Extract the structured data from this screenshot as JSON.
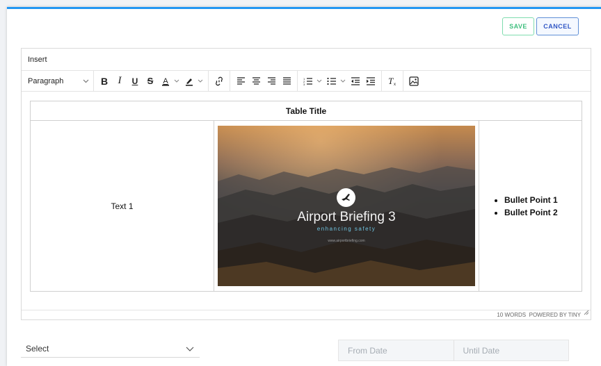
{
  "actions": {
    "save_label": "SAVE",
    "cancel_label": "CANCEL"
  },
  "editor": {
    "menubar": {
      "insert_label": "Insert"
    },
    "toolbar": {
      "block_format": "Paragraph",
      "buttons": [
        "bold",
        "italic",
        "underline",
        "strikethrough",
        "text-color",
        "highlight",
        "link",
        "align-left",
        "align-center",
        "align-right",
        "justify",
        "numbered-list",
        "bullet-list",
        "outdent",
        "indent",
        "clear-formatting",
        "image"
      ]
    },
    "table": {
      "title": "Table Title",
      "text_cell": "Text 1",
      "image": {
        "brand": "Airport Briefing 3",
        "tagline": "enhancing safety",
        "site": "www.airportbriefing.com"
      },
      "bullets": [
        "Bullet Point 1",
        "Bullet Point 2"
      ]
    },
    "status": {
      "word_count": "10 WORDS",
      "powered_by": "POWERED BY TINY"
    }
  },
  "filters": {
    "select_value": "Select",
    "from_date_placeholder": "From Date",
    "until_date_placeholder": "Until Date"
  },
  "colors": {
    "accent_top": "#2196f3",
    "save": "#3fbf7f",
    "cancel": "#2f55c4",
    "tagline": "#6fc3e0"
  }
}
